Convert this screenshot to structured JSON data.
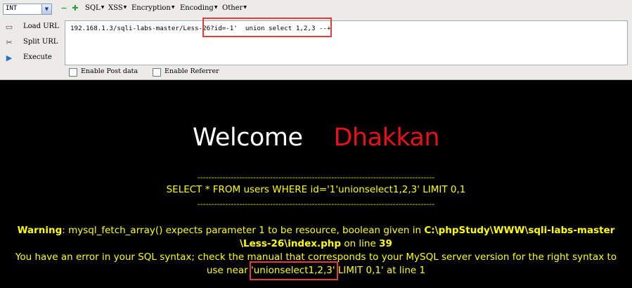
{
  "hackbar": {
    "select_value": "INT",
    "menus": [
      "SQL",
      "XSS",
      "Encryption",
      "Encoding",
      "Other"
    ],
    "actions": [
      {
        "label": "Load URL",
        "icon": "load-url-icon"
      },
      {
        "label": "Split URL",
        "icon": "split-url-icon"
      },
      {
        "label": "Execute",
        "icon": "execute-icon"
      }
    ],
    "url": "192.168.1.3/sqli-labs-master/Less-26?id=-1'  union select 1,2,3 --+",
    "checks": [
      "Enable Post data",
      "Enable Referrer"
    ],
    "accent_green": "#2fa12f",
    "highlight_color": "#e03c3c"
  },
  "page": {
    "welcome": "Welcome",
    "name": "Dhakkan",
    "dashes": "-------------------------------------------------------------------------------------",
    "query": "SELECT * FROM users WHERE id='1'unionselect1,2,3' LIMIT 0,1",
    "warning_label": "Warning",
    "warning_text": ": mysql_fetch_array() expects parameter 1 to be resource, boolean given in ",
    "warning_path_a": "C:\\phpStudy\\WWW\\sqli-labs-master",
    "warning_path_b": "\\Less-26\\index.php",
    "warning_online": " on line ",
    "warning_line": "39",
    "error_line1": "You have an error in your SQL syntax; check the manual that corresponds to your MySQL server version for the right syntax to",
    "error_line2": "use near 'unionselect1,2,3' LIMIT 0,1' at line 1",
    "title_white": "#ffffff",
    "title_red": "#e8101a",
    "text_yellow": "#ffff00"
  }
}
